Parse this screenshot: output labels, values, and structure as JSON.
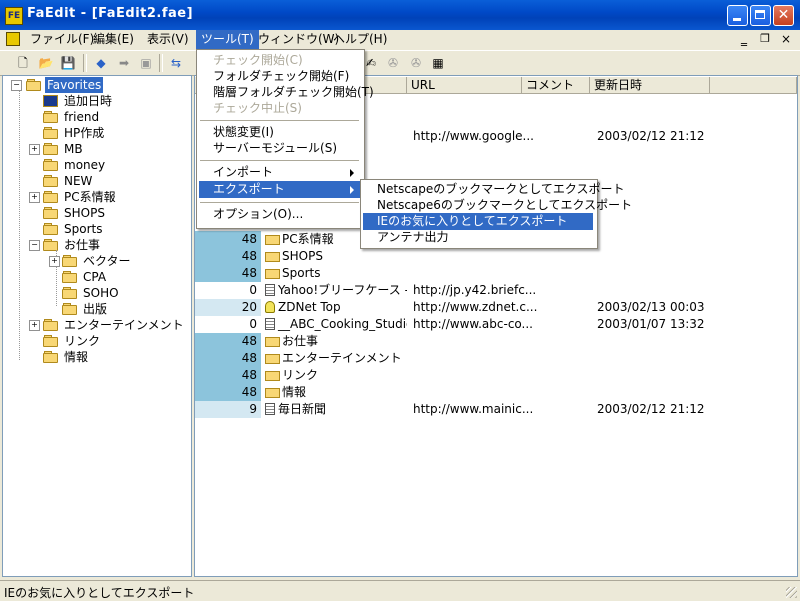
{
  "window": {
    "title": "FaEdit - [FaEdit2.fae]",
    "app_icon": "FE"
  },
  "menubar": [
    "ファイル(F)",
    "編集(E)",
    "表示(V)",
    "ツール(T)",
    "ウィンドウ(W)",
    "ヘルプ(H)"
  ],
  "tree": {
    "root": "Favorites",
    "items": [
      "追加日時",
      "friend",
      "HP作成",
      "MB",
      "money",
      "NEW",
      "PC系情報",
      "SHOPS",
      "Sports",
      "お仕事",
      "ベクター",
      "CPA",
      "SOHO",
      "出版",
      "エンターテインメント",
      "リンク",
      "情報"
    ]
  },
  "columns": [
    "URL",
    "コメント",
    "更新日時"
  ],
  "rows": [
    {
      "count": "",
      "name": "",
      "url": "http://www.google...",
      "date": "2003/02/12 21:12"
    },
    {
      "count": "48",
      "name": "PC系情報",
      "url": "",
      "date": ""
    },
    {
      "count": "48",
      "name": "SHOPS",
      "url": "",
      "date": ""
    },
    {
      "count": "48",
      "name": "Sports",
      "url": "",
      "date": ""
    },
    {
      "count": "0",
      "name": "Yahoo!ブリーフケース - リ...",
      "url": "http://jp.y42.briefc...",
      "date": ""
    },
    {
      "count": "20",
      "name": "ZDNet Top",
      "url": "http://www.zdnet.c...",
      "date": "2003/02/13 00:03"
    },
    {
      "count": "0",
      "name": "__ABC_Cooking_Studio...",
      "url": "http://www.abc-co...",
      "date": "2003/01/07 13:32"
    },
    {
      "count": "48",
      "name": "お仕事",
      "url": "",
      "date": ""
    },
    {
      "count": "48",
      "name": "エンターテインメント",
      "url": "",
      "date": ""
    },
    {
      "count": "48",
      "name": "リンク",
      "url": "",
      "date": ""
    },
    {
      "count": "48",
      "name": "情報",
      "url": "",
      "date": ""
    },
    {
      "count": "9",
      "name": "毎日新聞",
      "url": "http://www.mainic...",
      "date": "2003/02/12 21:12"
    }
  ],
  "tool_menu": {
    "items": [
      "チェック開始(C)",
      "フォルダチェック開始(F)",
      "階層フォルダチェック開始(T)",
      "チェック中止(S)",
      "状態変更(I)",
      "サーバーモジュール(S)",
      "インポート",
      "エクスポート",
      "オプション(O)..."
    ]
  },
  "export_menu": {
    "items": [
      "Netscapeのブックマークとしてエクスポート",
      "Netscape6のブックマークとしてエクスポート",
      "IEのお気に入りとしてエクスポート",
      "アンテナ出力"
    ]
  },
  "statusbar": {
    "text": "IEのお気に入りとしてエクスポート"
  },
  "colors": {
    "title_bar": "#0a5fd8",
    "selection": "#316ac5",
    "count_dark": "#8cc4dc",
    "count_light": "#d4e8f2"
  }
}
